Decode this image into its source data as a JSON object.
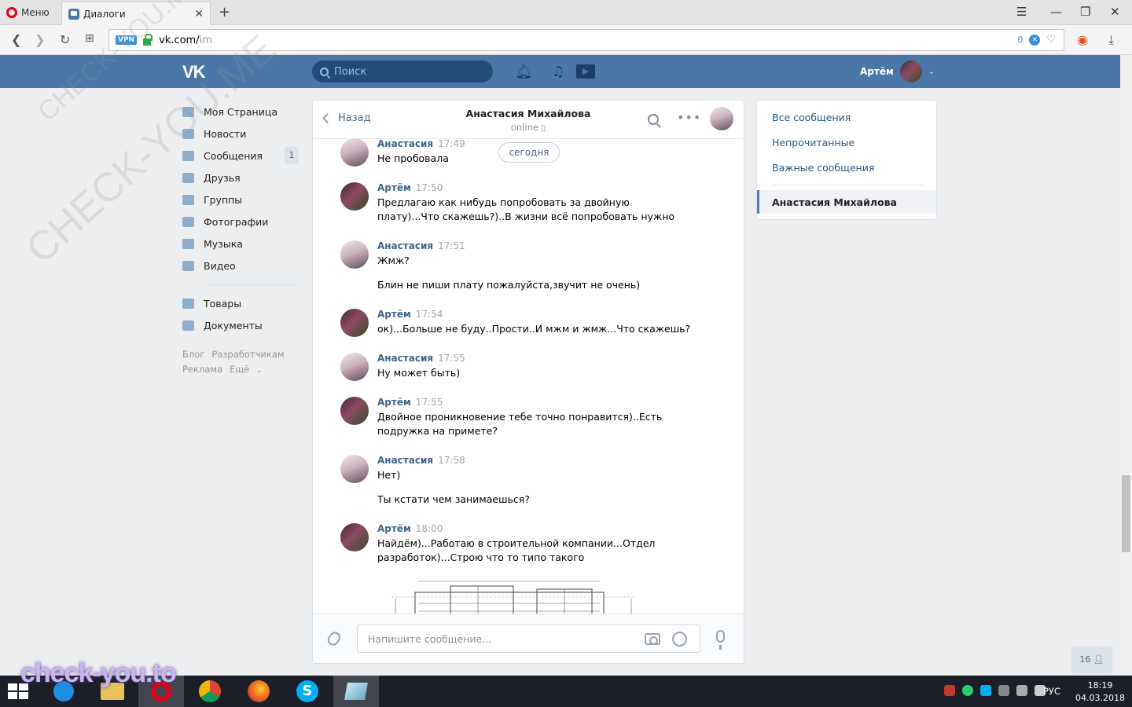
{
  "browser": {
    "menu_label": "Меню",
    "tab_title": "Диалоги",
    "url_host": "vk.com/",
    "url_path": "im",
    "vpn_badge": "VPN",
    "blocked_count": "0"
  },
  "header": {
    "logo": "VK",
    "search_placeholder": "Поиск",
    "user_name": "Артём"
  },
  "sidebar": {
    "items": [
      {
        "label": "Моя Страница",
        "icon": "home-icon"
      },
      {
        "label": "Новости",
        "icon": "news-icon"
      },
      {
        "label": "Сообщения",
        "icon": "messages-icon",
        "count": "1"
      },
      {
        "label": "Друзья",
        "icon": "friends-icon"
      },
      {
        "label": "Группы",
        "icon": "groups-icon"
      },
      {
        "label": "Фотографии",
        "icon": "photos-icon"
      },
      {
        "label": "Музыка",
        "icon": "music-icon"
      },
      {
        "label": "Видео",
        "icon": "video-icon"
      },
      {
        "label": "Товары",
        "icon": "market-icon"
      },
      {
        "label": "Документы",
        "icon": "documents-icon"
      }
    ],
    "footer": [
      "Блог",
      "Разработчикам",
      "Реклама",
      "Ещё"
    ]
  },
  "chat": {
    "back_label": "Назад",
    "peer_name": "Анастасия Михайлова",
    "peer_status": "online",
    "today_label": "сегодня",
    "input_placeholder": "Напишите сообщение...",
    "messages": [
      {
        "author": "Анастасия",
        "time": "17:49",
        "lines": [
          "Не пробовала"
        ]
      },
      {
        "author": "Артём",
        "time": "17:50",
        "lines": [
          "Предлагаю как нибудь попробовать за двойную плату)...Что скажешь?)..В жизни всё попробовать нужно"
        ]
      },
      {
        "author": "Анастасия",
        "time": "17:51",
        "lines": [
          "Жмж?",
          "Блин не пиши плату пожалуйста,звучит не очень)"
        ]
      },
      {
        "author": "Артём",
        "time": "17:54",
        "lines": [
          "ок)...Больше не буду..Прости..И мжм и жмж...Что скажешь?"
        ]
      },
      {
        "author": "Анастасия",
        "time": "17:55",
        "lines": [
          "Ну может быть)"
        ]
      },
      {
        "author": "Артём",
        "time": "17:55",
        "lines": [
          "Двойное проникновение тебе точно понравится)..Есть подружка на примете?"
        ]
      },
      {
        "author": "Анастасия",
        "time": "17:58",
        "lines": [
          "Нет)",
          "Ты кстати чем занимаешься?"
        ]
      },
      {
        "author": "Артём",
        "time": "18:00",
        "lines": [
          "Найдём)...Работаю в строительной компании...Отдел разработок)...Строю что то типо такого"
        ]
      }
    ]
  },
  "filters": {
    "items": [
      "Все сообщения",
      "Непрочитанные",
      "Важные сообщения"
    ],
    "active": "Анастасия Михайлова"
  },
  "online_counter": "16",
  "taskbar": {
    "lang": "РУС",
    "time": "18:19",
    "date": "04.03.2018"
  },
  "watermark": "check-you.to",
  "watermark_diag": "CHECK-YOU.ME"
}
